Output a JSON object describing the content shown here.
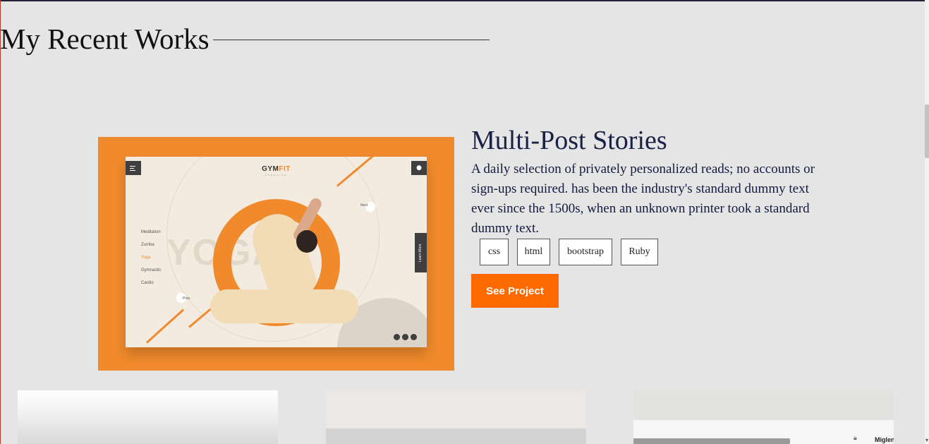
{
  "section": {
    "title": "My Recent Works"
  },
  "featured_project": {
    "title": "Multi-Post Stories",
    "description": "A daily selection of privately personalized reads; no accounts or sign-ups required. has been the industry's standard dummy text ever since the 1500s, when an unknown printer took a standard dummy text.",
    "tags": [
      "css",
      "html",
      "bootstrap",
      "Ruby"
    ],
    "cta_label": "See Project",
    "preview": {
      "logo_main": "GYM",
      "logo_accent": "FIT",
      "logo_sub": "EXERCISE",
      "background_word": "YOGA",
      "menu_items": [
        "Meditation",
        "Zumba",
        "Yoga",
        "Gymnastic",
        "Cardio"
      ],
      "active_menu_item": "Yoga",
      "next_label": "Next",
      "prev_label": "Prev",
      "side_button_label": "Learn More"
    }
  },
  "cards": [
    {
      "brand_text": ""
    },
    {
      "brand_text": ""
    },
    {
      "brand_text": "Miglen"
    }
  ],
  "colors": {
    "background": "#e5e5e5",
    "accent_orange": "#ff6a00",
    "preview_orange": "#f08a2c",
    "title_navy": "#1b2145"
  }
}
